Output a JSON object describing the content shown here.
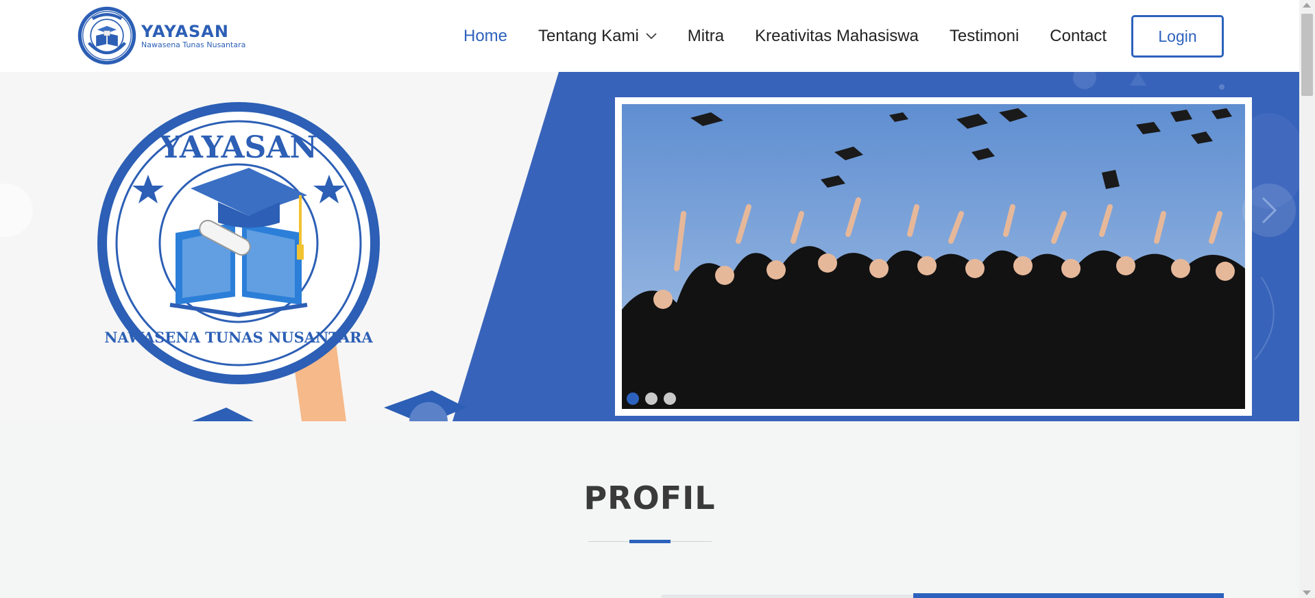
{
  "brand": {
    "title": "YAYASAN",
    "subtitle": "Nawasena Tunas Nusantara",
    "emblem_top": "YAYASAN",
    "emblem_bottom": "NAWASENA TUNAS NUSANTARA"
  },
  "nav": {
    "items": [
      {
        "label": "Home",
        "active": true
      },
      {
        "label": "Tentang Kami",
        "dropdown": true
      },
      {
        "label": "Mitra"
      },
      {
        "label": "Kreativitas Mahasiswa"
      },
      {
        "label": "Testimoni"
      },
      {
        "label": "Contact"
      }
    ],
    "login_label": "Login"
  },
  "hero": {
    "slides_count": 3,
    "active_slide": 1
  },
  "profil": {
    "title": "PROFIL"
  },
  "colors": {
    "accent": "#2c62bd",
    "hero_blue": "#3863ba",
    "text": "#222222"
  },
  "icons": [
    "chevron-down-icon",
    "chevron-right-icon",
    "logo-emblem"
  ]
}
